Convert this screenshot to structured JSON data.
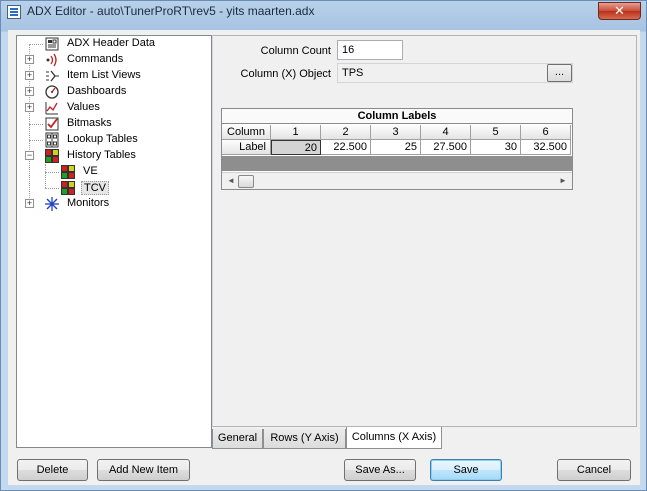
{
  "window": {
    "title": "ADX Editor - auto\\TunerProRT\\rev5 - yits maarten.adx",
    "close_glyph": "✕"
  },
  "tree": {
    "items": [
      {
        "label": "ADX Header Data",
        "icon": "header-data-icon"
      },
      {
        "label": "Commands",
        "icon": "commands-icon",
        "expander": "+"
      },
      {
        "label": "Item List Views",
        "icon": "item-list-icon",
        "expander": "+"
      },
      {
        "label": "Dashboards",
        "icon": "dashboard-gauge-icon",
        "expander": "+"
      },
      {
        "label": "Values",
        "icon": "values-graph-icon",
        "expander": "+"
      },
      {
        "label": "Bitmasks",
        "icon": "bitmask-check-icon"
      },
      {
        "label": "Lookup Tables",
        "icon": "lookup-table-icon"
      },
      {
        "label": "History Tables",
        "icon": "history-table-icon",
        "expander": "−"
      },
      {
        "label": "VE",
        "icon": "history-table-icon"
      },
      {
        "label": "TCV",
        "icon": "history-table-icon"
      },
      {
        "label": "Monitors",
        "icon": "monitor-star-icon",
        "expander": "+"
      }
    ]
  },
  "form": {
    "column_count_label": "Column Count",
    "column_count_value": "16",
    "column_object_label": "Column (X) Object",
    "column_object_value": "TPS",
    "ellipsis_label": "..."
  },
  "grid": {
    "title": "Column Labels",
    "corner_label": "Column",
    "row_label": "Label",
    "columns": [
      "1",
      "2",
      "3",
      "4",
      "5",
      "6"
    ],
    "values": [
      "20",
      "22.500",
      "25",
      "27.500",
      "30",
      "32.500"
    ],
    "scroll_left": "◄",
    "scroll_right": "►"
  },
  "tabs": [
    {
      "label": "General"
    },
    {
      "label": "Rows (Y Axis)"
    },
    {
      "label": "Columns (X Axis)"
    }
  ],
  "buttons": {
    "delete": "Delete",
    "add_new_item": "Add New Item",
    "save_as": "Save As...",
    "save": "Save",
    "cancel": "Cancel"
  }
}
